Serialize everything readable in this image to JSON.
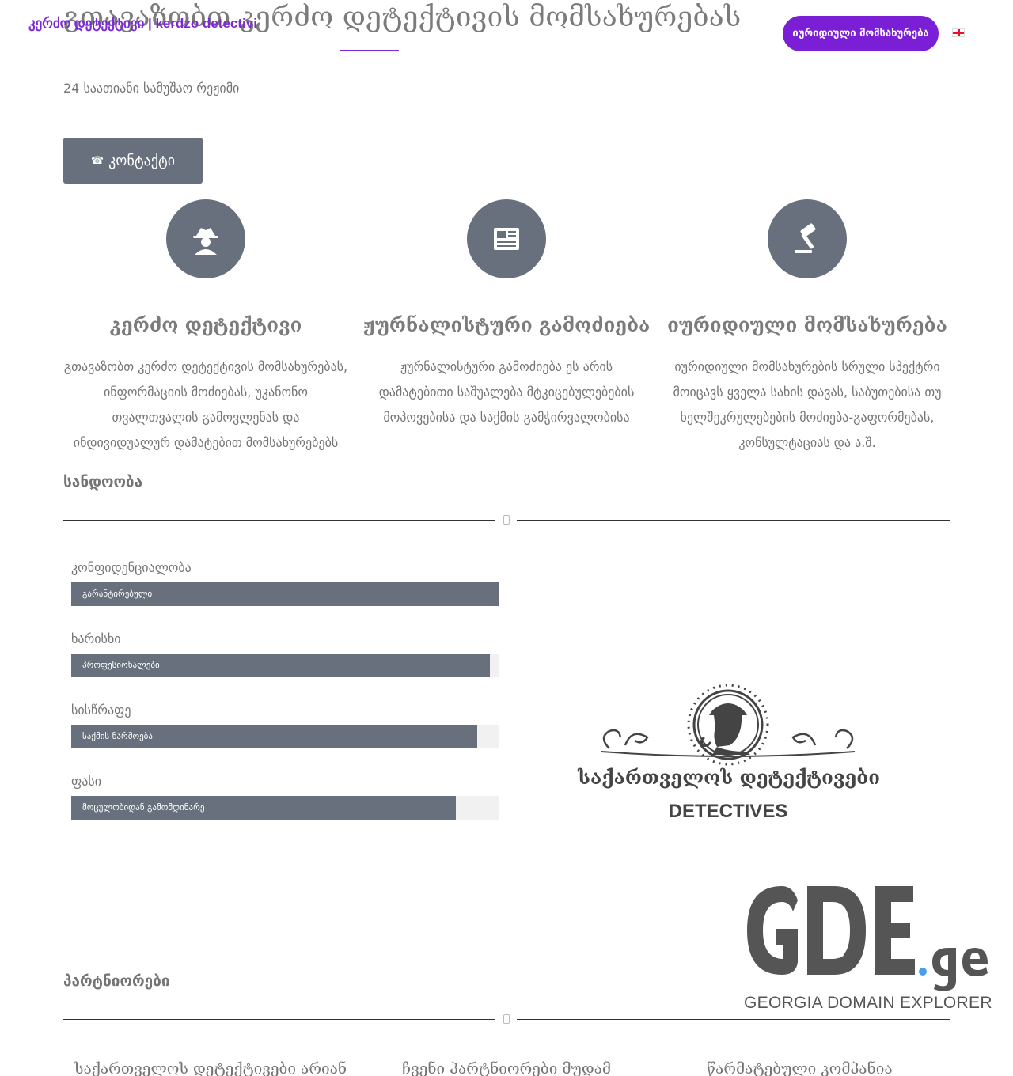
{
  "header": {
    "hero_title": "გთავაზობთ კერძო დეტექტივის მომსახურებას",
    "brand": "კერძო დეტექტივი | kerdzo detectivi",
    "cta_label": "იურიდიული მომსახურება",
    "language_flag": "georgian-flag-icon"
  },
  "intro": {
    "subtitle": "24 საათიანი სამუშაო რეჟიმი",
    "contact_button": "კონტაქტი",
    "contact_icon": "phone-icon"
  },
  "services": [
    {
      "icon": "user-secret-icon",
      "title": "კერძო დეტექტივი",
      "text": "გთავაზობთ კერძო დეტექტივის მომსახურებას, ინფორმაციის მოძიებას, უკანონო თვალთვალის გამოვლენას და ინდივიდუალურ დამატებით მომსახურებებს"
    },
    {
      "icon": "newspaper-icon",
      "title": "ჟურნალისტური გამოძიება",
      "text": "ჟურნალისტური გამოძიება ეს არის დამატებითი საშუალება მტკიცებულებების მოპოვებისა და საქმის გამჭირვალობისა"
    },
    {
      "icon": "gavel-icon",
      "title": "იურიდიული მომსახურება",
      "text": "იურიდიული მომსახურების სრული სპექტრი მოიცავს ყველა სახის დავას, საბუთებისა თუ ხელშეკრულებების მოძიება-გაფორმებას, კონსულტაციას და ა.შ."
    }
  ],
  "reliability": {
    "title": "სანდოობა",
    "skills": [
      {
        "label": "კონფიდენციალობა",
        "bar_text": "გარანტირებული",
        "percent": 100
      },
      {
        "label": "ხარისხი",
        "bar_text": "პროფესიონალები",
        "percent": 98
      },
      {
        "label": "სისწრაფე",
        "bar_text": "საქმის წარმოება",
        "percent": 95
      },
      {
        "label": "ფასი",
        "bar_text": "მოცულობიდან გამომდინარე",
        "percent": 90
      }
    ]
  },
  "logos": {
    "detective_ka": "საქართველოს დეტექტივები",
    "detective_en": "DETECTIVES",
    "gde_tagline": "GEORGIA DOMAIN EXPLORER"
  },
  "partners": {
    "title": "პარტნიორები",
    "columns": [
      "საქართველოს დეტექტივები არიან",
      "ჩვენი პარტნიორები მუდამ",
      "წარმატებული კომპანია"
    ]
  }
}
